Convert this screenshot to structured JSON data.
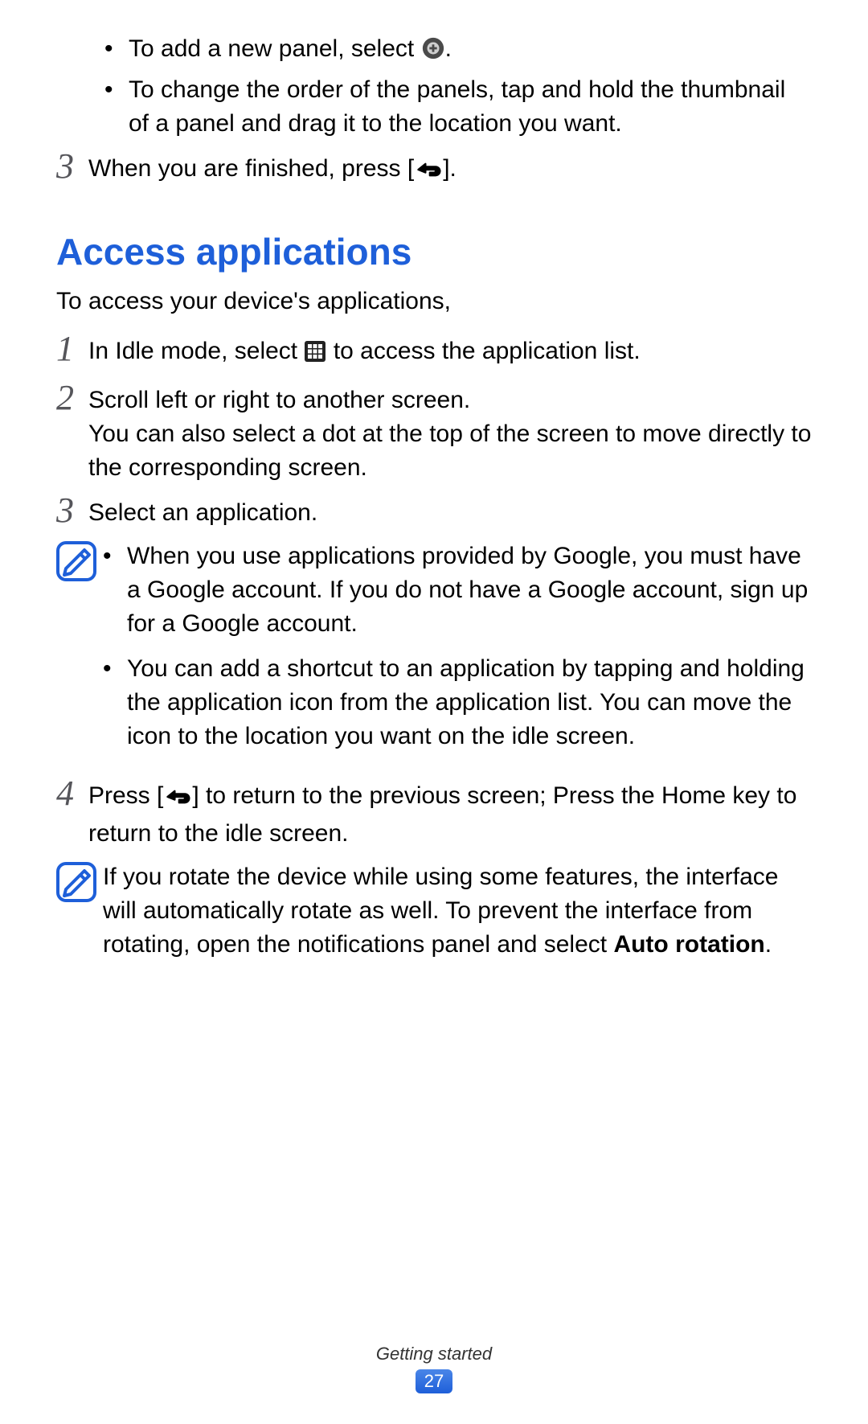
{
  "top_bullets": [
    {
      "pre": "To add a new panel, select ",
      "after": ".",
      "icon": "add-circle"
    },
    {
      "text": "To change the order of the panels, tap and hold the thumbnail of a panel and drag it to the location you want."
    }
  ],
  "step3a": {
    "num": "3",
    "pre": "When you are finished, press [",
    "after": "].",
    "icon": "back"
  },
  "section_heading": "Access applications",
  "intro": "To access your device's applications,",
  "step1": {
    "num": "1",
    "pre": "In Idle mode, select ",
    "after": " to access the application list.",
    "icon": "grid"
  },
  "step2": {
    "num": "2",
    "line1": "Scroll left or right to another screen.",
    "line2": "You can also select a dot at the top of the screen to move directly to the corresponding screen."
  },
  "step3b": {
    "num": "3",
    "text": "Select an application."
  },
  "note1": [
    "When you use applications provided by Google, you must have a Google account. If you do not have a Google account, sign up for a Google account.",
    "You can add a shortcut to an application by tapping and holding the application icon from the application list. You can move the icon to the location you want on the idle screen."
  ],
  "step4": {
    "num": "4",
    "pre": "Press [",
    "after": "] to return to the previous screen; Press the Home key to return to the idle screen.",
    "icon": "back"
  },
  "note2": {
    "pre": "If you rotate the device while using some features, the interface will automatically rotate as well. To prevent the interface from rotating, open the notifications panel and select ",
    "bold": "Auto rotation",
    "after": "."
  },
  "footer_section": "Getting started",
  "page_number": "27"
}
